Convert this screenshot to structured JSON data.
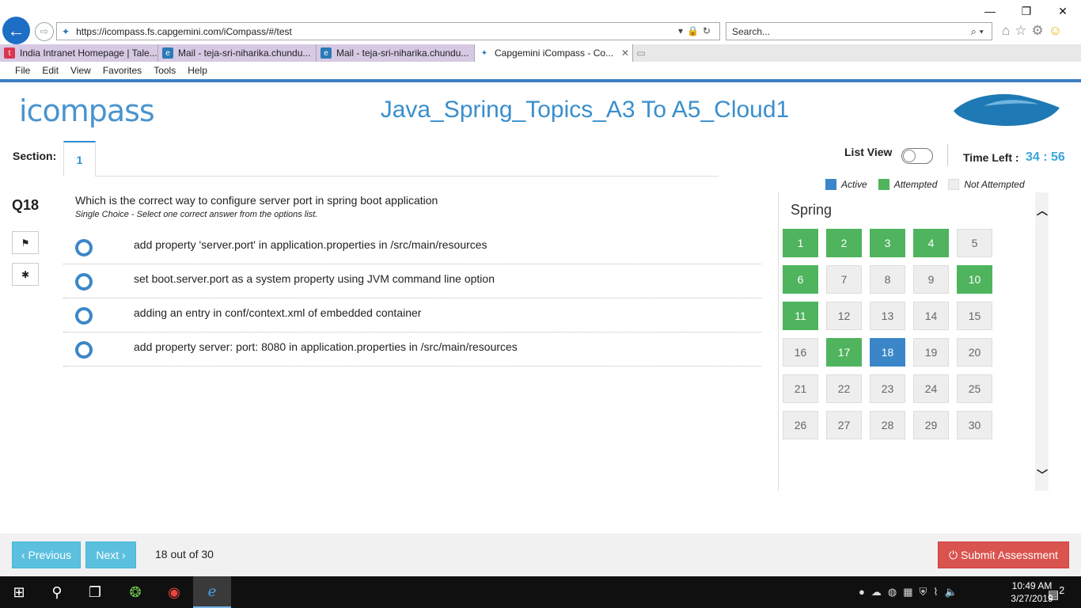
{
  "browser": {
    "url": "https://icompass.fs.capgemini.com/iCompass/#/test",
    "search_placeholder": "Search...",
    "tabs": [
      {
        "label": "India Intranet Homepage | Tale...",
        "icon": "t",
        "icon_color": "#d9364f"
      },
      {
        "label": "Mail - teja-sri-niharika.chundu...",
        "icon": "e",
        "icon_color": "#2a7ab8"
      },
      {
        "label": "Mail - teja-sri-niharika.chundu...",
        "icon": "e",
        "icon_color": "#2a7ab8"
      },
      {
        "label": "Capgemini iCompass - Co...",
        "icon": "✦",
        "icon_color": "#2a7ab8"
      }
    ],
    "menu": [
      "File",
      "Edit",
      "View",
      "Favorites",
      "Tools",
      "Help"
    ]
  },
  "app": {
    "logo_text": "icompass",
    "title": "Java_Spring_Topics_A3 To A5_Cloud1",
    "section_label": "Section:",
    "section_tab": "1",
    "list_view_label": "List View",
    "time_left_label": "Time Left :",
    "time_left_value": "34 : 56"
  },
  "question": {
    "number": "Q18",
    "text": "Which is the correct way to configure server port in spring boot application",
    "subtext": "Single Choice - Select one correct answer from the options list.",
    "options": [
      "add property 'server.port' in application.properties in /src/main/resources",
      "set boot.server.port as a system property using JVM command line option",
      "adding an entry in conf/context.xml of embedded container",
      "add property server: port: 8080 in application.properties in /src/main/resources"
    ]
  },
  "legend": {
    "active": "Active",
    "attempted": "Attempted",
    "not_attempted": "Not Attempted",
    "colors": {
      "active": "#3a86c8",
      "attempted": "#4fb45d",
      "not_attempted": "#eeeeee"
    }
  },
  "palette": {
    "title": "Spring",
    "questions": [
      {
        "n": "1",
        "s": "attempted"
      },
      {
        "n": "2",
        "s": "attempted"
      },
      {
        "n": "3",
        "s": "attempted"
      },
      {
        "n": "4",
        "s": "attempted"
      },
      {
        "n": "5",
        "s": "not"
      },
      {
        "n": "6",
        "s": "attempted"
      },
      {
        "n": "7",
        "s": "not"
      },
      {
        "n": "8",
        "s": "not"
      },
      {
        "n": "9",
        "s": "not"
      },
      {
        "n": "10",
        "s": "attempted"
      },
      {
        "n": "11",
        "s": "attempted"
      },
      {
        "n": "12",
        "s": "not"
      },
      {
        "n": "13",
        "s": "not"
      },
      {
        "n": "14",
        "s": "not"
      },
      {
        "n": "15",
        "s": "not"
      },
      {
        "n": "16",
        "s": "not"
      },
      {
        "n": "17",
        "s": "attempted"
      },
      {
        "n": "18",
        "s": "active"
      },
      {
        "n": "19",
        "s": "not"
      },
      {
        "n": "20",
        "s": "not"
      },
      {
        "n": "21",
        "s": "not"
      },
      {
        "n": "22",
        "s": "not"
      },
      {
        "n": "23",
        "s": "not"
      },
      {
        "n": "24",
        "s": "not"
      },
      {
        "n": "25",
        "s": "not"
      },
      {
        "n": "26",
        "s": "not"
      },
      {
        "n": "27",
        "s": "not"
      },
      {
        "n": "28",
        "s": "not"
      },
      {
        "n": "29",
        "s": "not"
      },
      {
        "n": "30",
        "s": "not"
      }
    ]
  },
  "footer": {
    "previous_label": "‹ Previous",
    "next_label": "Next ›",
    "progress": "18 out of 30",
    "submit_label": "⏻ Submit Assessment"
  },
  "taskbar": {
    "time": "10:49 AM",
    "date": "3/27/2019",
    "notifications": "2"
  }
}
